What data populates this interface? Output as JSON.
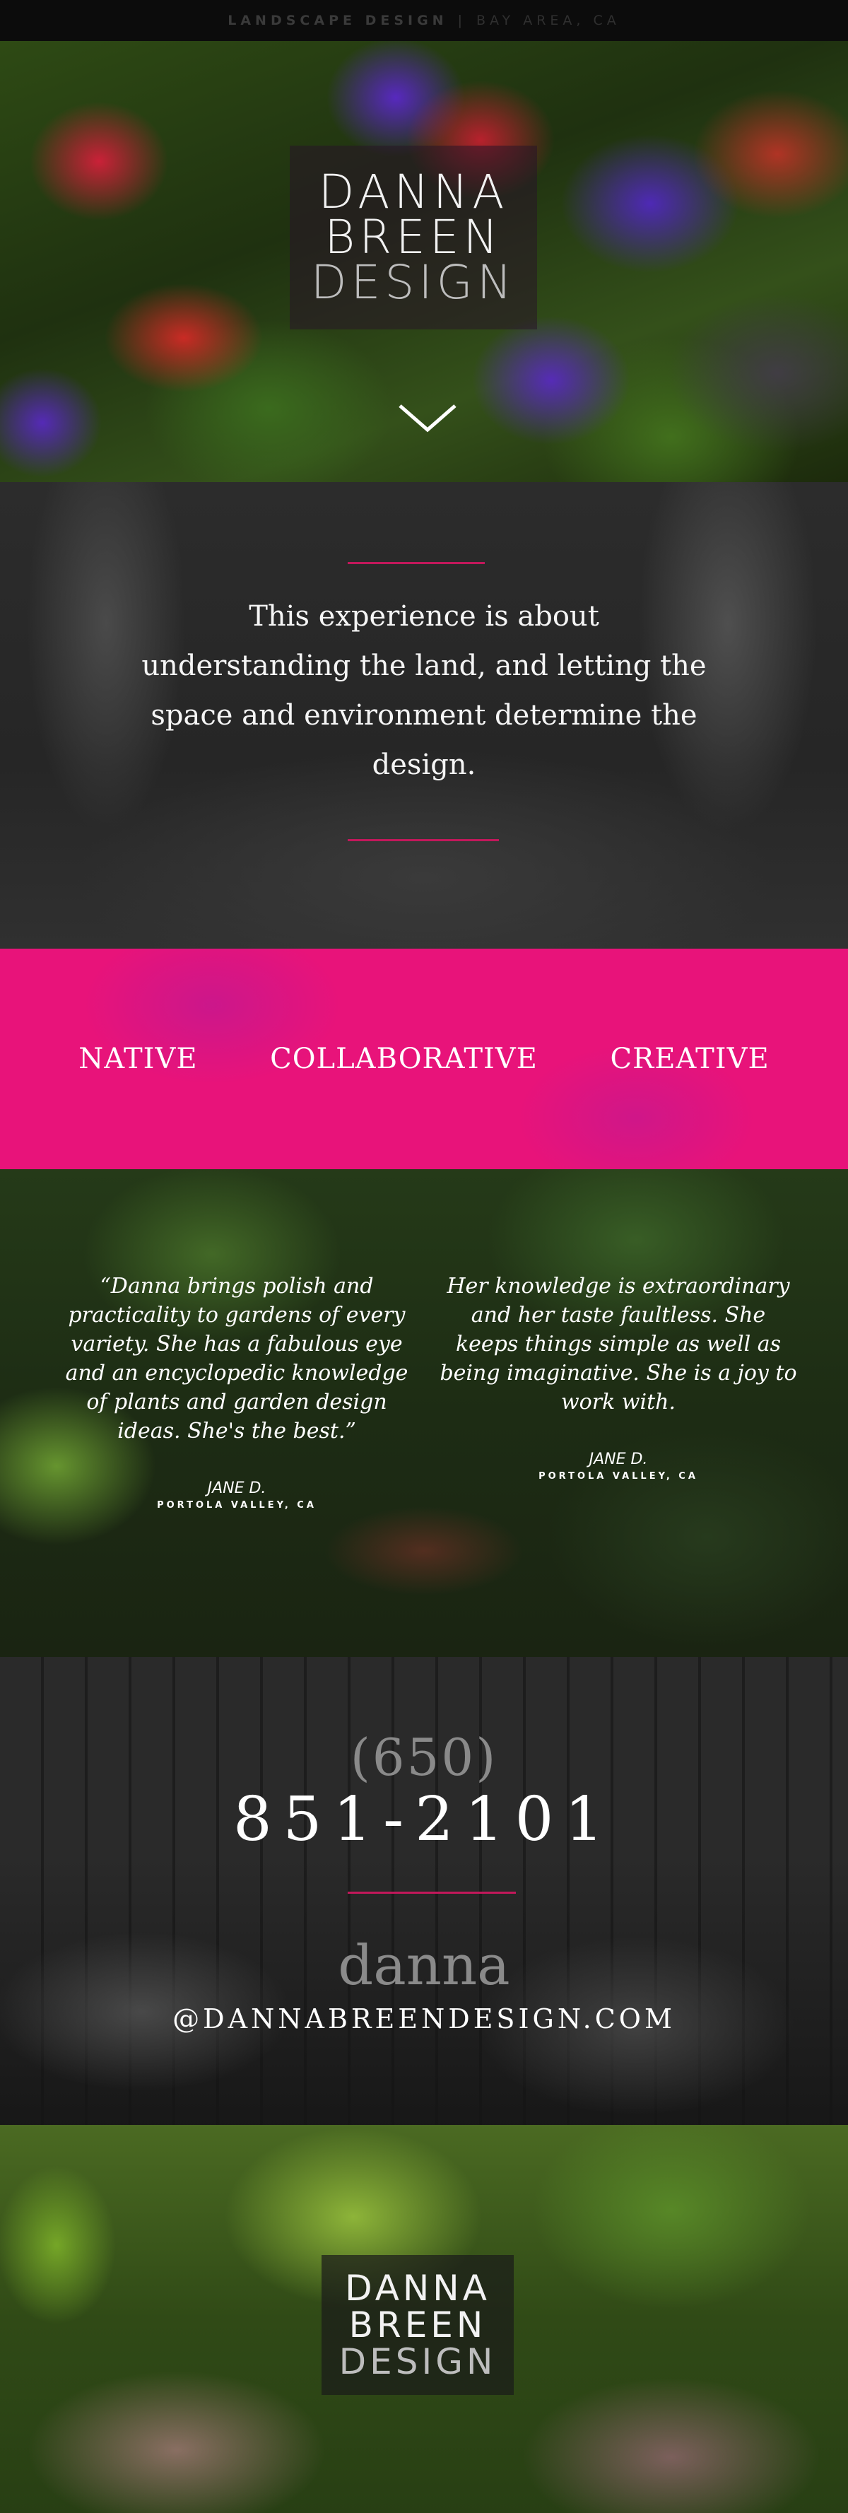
{
  "topbar": {
    "tagline": "LANDSCAPE DESIGN",
    "separator": "|",
    "location": "BAY AREA, CA"
  },
  "hero": {
    "logo_line1": "DANNA",
    "logo_line2": "BREEN",
    "logo_line3": "DESIGN",
    "scroll_icon": "chevron-down-icon"
  },
  "statement": {
    "text": "This experience is about understanding the land, and letting the space and environment determine the design."
  },
  "values": [
    "NATIVE",
    "COLLABORATIVE",
    "CREATIVE"
  ],
  "testimonials": [
    {
      "quote": "“Danna brings polish and practicality to gardens of every variety.  She has a fabulous eye and an encyclopedic knowledge of plants and garden design ideas.  She's the best.”",
      "name": "JANE D.",
      "place": "PORTOLA VALLEY, CA"
    },
    {
      "quote": "Her knowledge is extraordinary and her taste faultless. She keeps things simple as well as being imaginative.  She is a joy to work with.",
      "name": "JANE D.",
      "place": "PORTOLA VALLEY, CA"
    }
  ],
  "contact": {
    "area_code": "(650)",
    "number": "851-2101",
    "name": "danna",
    "email": "@DANNABREENDESIGN.COM"
  },
  "footer": {
    "logo_line1": "DANNA",
    "logo_line2": "BREEN",
    "logo_line3": "DESIGN"
  },
  "colors": {
    "accent": "#e8137a",
    "rule": "#c2185b"
  }
}
